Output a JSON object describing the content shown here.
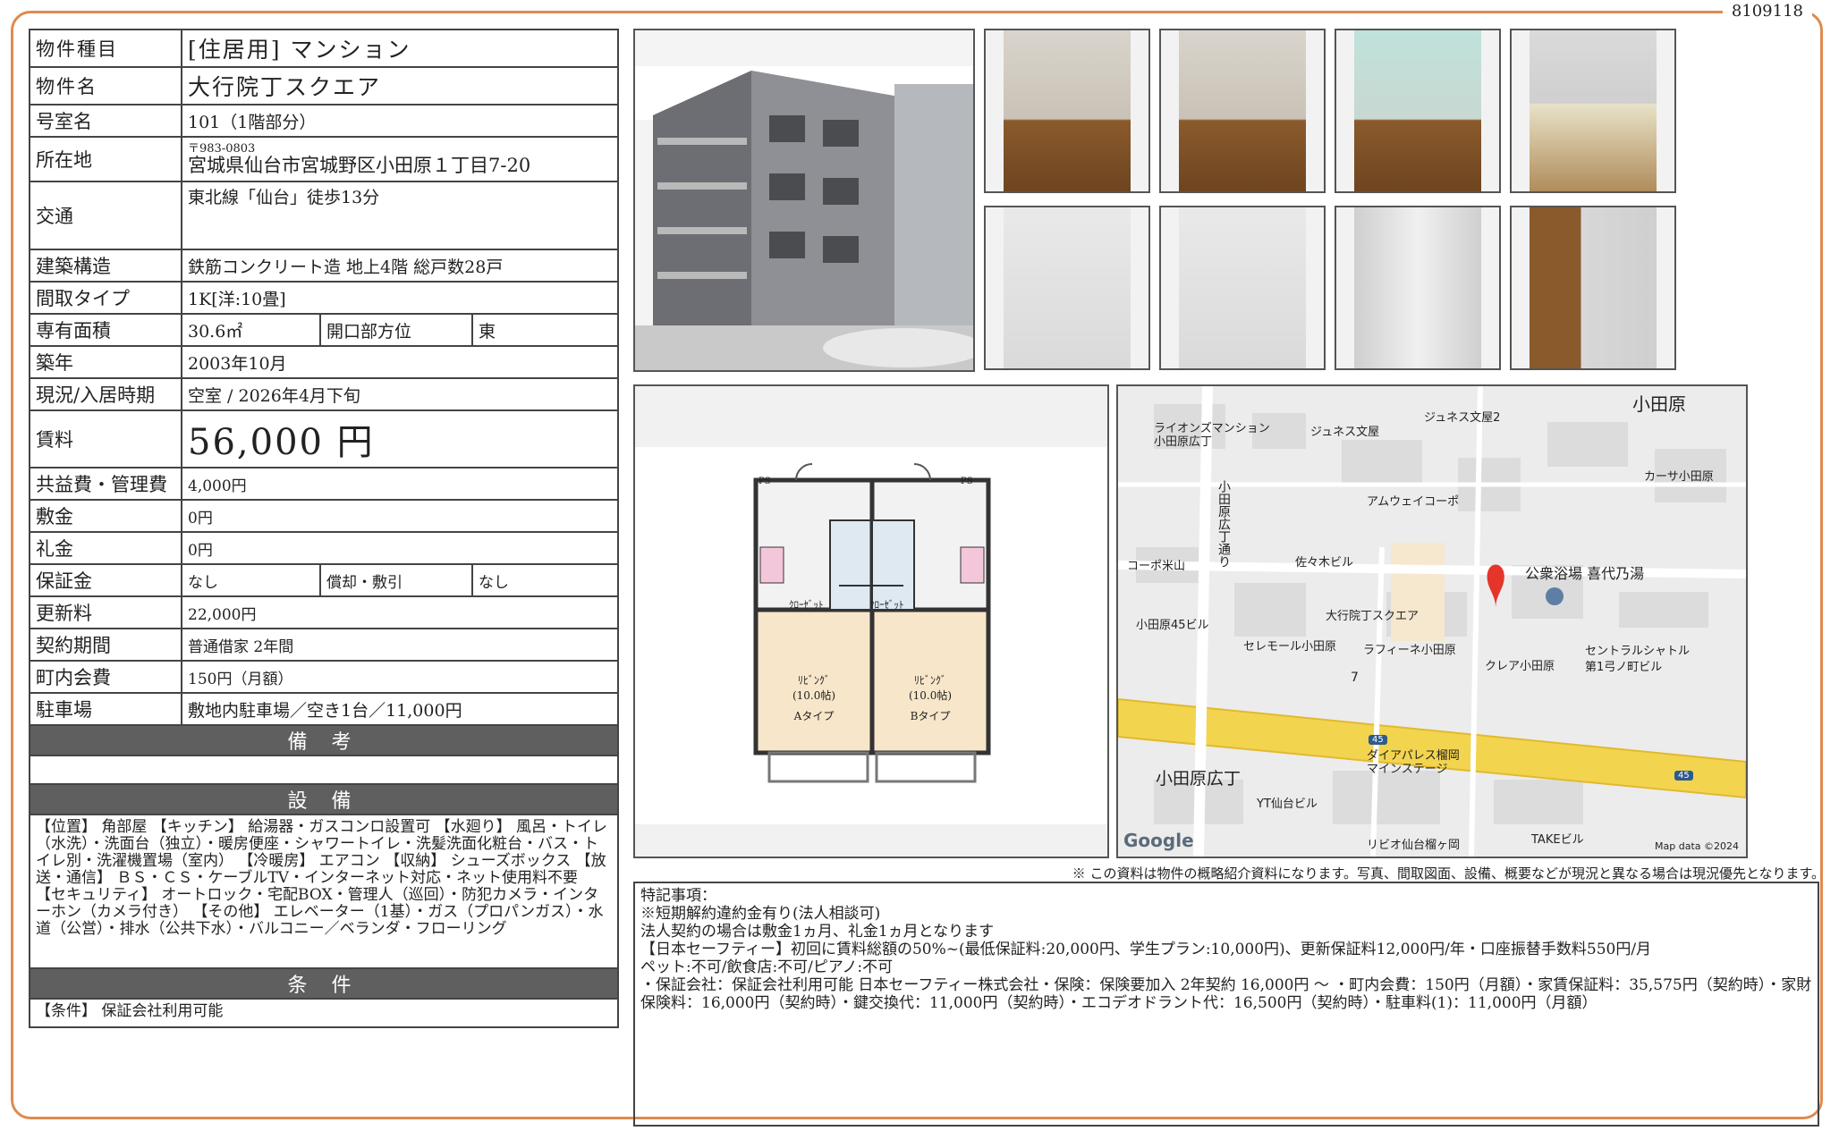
{
  "doc_id": "8109118",
  "spec": {
    "type_label": "物件種目",
    "type_value": "[住居用] マンション",
    "name_label": "物件名",
    "name_value": "大行院丁スクエア",
    "room_label": "号室名",
    "room_value": "101（1階部分）",
    "address_label": "所在地",
    "address_zip": "〒983-0803",
    "address_value": "宮城県仙台市宮城野区小田原１丁目7-20",
    "traffic_label": "交通",
    "traffic_value": "東北線「仙台」徒歩13分",
    "structure_label": "建築構造",
    "structure_value": "鉄筋コンクリート造 地上4階 総戸数28戸",
    "layout_label": "間取タイプ",
    "layout_value": "1K[洋:10畳]",
    "area_label": "専有面積",
    "area_value": "30.6㎡",
    "opening_label": "開口部方位",
    "opening_value": "東",
    "built_label": "築年",
    "built_value": "2003年10月",
    "status_label": "現況/入居時期",
    "status_value": "空室 / 2026年4月下旬",
    "rent_label": "賃料",
    "rent_value": "56,000 円",
    "fee_label": "共益費・管理費",
    "fee_value": "4,000円",
    "deposit_label": "敷金",
    "deposit_value": "0円",
    "key_money_label": "礼金",
    "key_money_value": "0円",
    "guarantee_label": "保証金",
    "guarantee_value": "なし",
    "amortize_label": "償却・敷引",
    "amortize_value": "なし",
    "renewal_label": "更新料",
    "renewal_value": "22,000円",
    "contract_label": "契約期間",
    "contract_value": "普通借家 2年間",
    "town_fee_label": "町内会費",
    "town_fee_value": "150円（月額）",
    "parking_label": "駐車場",
    "parking_value": "敷地内駐車場／空き1台／11,000円",
    "remarks_header": "備 考",
    "equipment_header": "設 備",
    "equipment_text": "【位置】 角部屋 【キッチン】 給湯器・ガスコンロ設置可 【水廻り】 風呂・トイレ（水洗）・洗面台（独立）・暖房便座・シャワートイレ・洗髪洗面化粧台・バス・トイレ別・洗濯機置場（室内） 【冷暖房】 エアコン 【収納】 シューズボックス 【放送・通信】 ＢＳ・ＣＳ・ケーブルTV・インターネット対応・ネット使用料不要 【セキュリティ】 オートロック・宅配BOX・管理人（巡回）・防犯カメラ・インターホン（カメラ付き） 【その他】 エレベーター（1基）・ガス（プロパンガス）・水道（公営）・排水（公共下水）・バルコニー／ベランダ・フローリング",
    "conditions_header": "条 件",
    "conditions_text": "【条件】 保証会社利用可能"
  },
  "plan": {
    "room_a_label": "ﾘﾋﾞﾝｸﾞ\n(10.0帖)",
    "room_a_type": "Aタイプ",
    "room_b_label": "ﾘﾋﾞﾝｸﾞ\n(10.0帖)",
    "room_b_type": "Bタイプ",
    "closet": "ｸﾛｰｾﾞｯﾄ",
    "ps": "PS"
  },
  "map": {
    "labels": {
      "odawara": "小田原",
      "lions": "ライオンズマンション\n小田原広丁",
      "junes": "ジュネス文屋",
      "junes2": "ジュネス文屋2",
      "casa": "カーサ小田原",
      "amway": "アムウェイコーポ",
      "cora": "コーポ米山",
      "sasaki": "佐々木ビル",
      "street": "小田原広丁通り",
      "bath": "公衆浴場 喜代乃湯",
      "target": "大行院丁スクエア",
      "bldg45": "小田原45ビル",
      "seremol": "セレモール小田原",
      "rafine": "ラフィーネ小田原",
      "clair": "クレア小田原",
      "central": "セントラルシャトル\n第1弓ノ町ビル",
      "num7": "7",
      "route45a": "45",
      "route45b": "45",
      "dia": "ダイアパレス榴岡\nマインステージ",
      "hirocho": "小田原広丁",
      "yt": "YT仙台ビル",
      "rivio": "リビオ仙台榴ヶ岡",
      "take": "TAKEビル",
      "google": "Google",
      "mapdata": "Map data ©2024"
    }
  },
  "disclaimer": "※ この資料は物件の概略紹介資料になります。写真、間取図面、設備、概要などが現況と異なる場合は現況優先となります。",
  "remarks_lines": [
    "特記事項：",
    "※短期解約違約金有り(法人相談可)",
    "法人契約の場合は敷金1ヵ月、礼金1ヵ月となります",
    "【日本セーフティー】初回に賃料総額の50%~(最低保証料:20,000円、学生プラン:10,000円)、更新保証料12,000円/年・口座振替手数料550円/月",
    "ペット:不可/飲食店:不可/ピアノ:不可",
    "・保証会社：保証会社利用可能 日本セーフティー株式会社・保険：保険要加入 2年契約 16,000円 〜 ・町内会費：150円（月額）・家賃保証料：35,575円（契約時）・家財保険料：16,000円（契約時）・鍵交換代：11,000円（契約時）・エコデオドラント代：16,500円（契約時）・駐車料(1)：11,000円（月額）"
  ]
}
